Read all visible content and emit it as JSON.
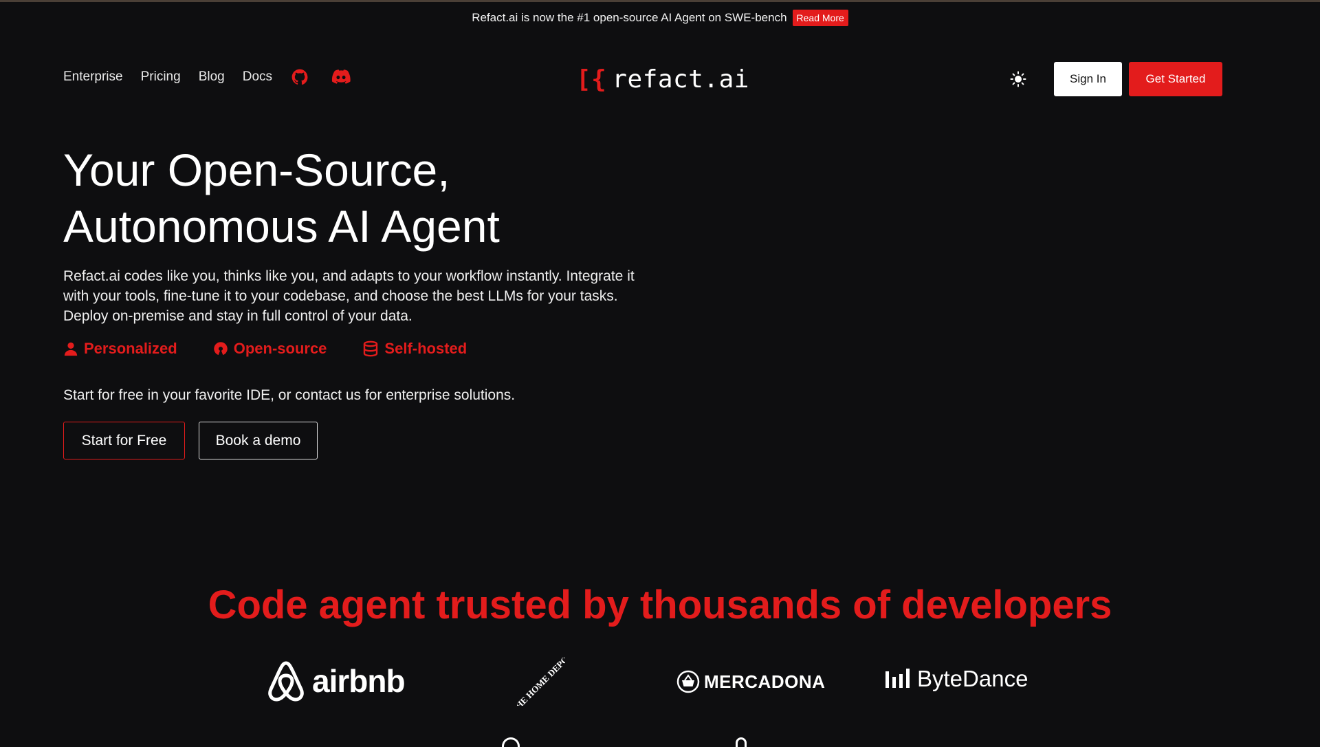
{
  "announcement": {
    "text": "Refact.ai is now the #1 open-source AI Agent on SWE-bench",
    "badge": "Read More"
  },
  "nav": {
    "links": [
      "Enterprise",
      "Pricing",
      "Blog",
      "Docs"
    ],
    "icons": [
      "github-icon",
      "discord-icon"
    ]
  },
  "logo": {
    "mark": "[{",
    "text": "refact.ai"
  },
  "header_right": {
    "theme_icon": "sun-icon",
    "sign_in": "Sign In",
    "get_started": "Get Started"
  },
  "hero": {
    "title_line1": "Your Open-Source,",
    "title_line2": "Autonomous AI Agent",
    "description": "Refact.ai codes like you, thinks like you, and adapts to your workflow instantly. Integrate it with your tools, fine-tune it to your codebase, and choose the best LLMs for your tasks. Deploy on-premise and stay in full control of your data.",
    "features": [
      {
        "label": "Personalized",
        "icon": "user-icon"
      },
      {
        "label": "Open-source",
        "icon": "open-source-icon"
      },
      {
        "label": "Self-hosted",
        "icon": "database-icon"
      }
    ],
    "cta_text": "Start for free in your favorite IDE, or contact us for enterprise solutions.",
    "start_free": "Start for Free",
    "book_demo": "Book a demo"
  },
  "trusted": {
    "heading": "Code agent trusted by thousands of developers",
    "logos": [
      "airbnb",
      "THE HOME DEPOT",
      "MERCADONA",
      "ByteDance"
    ]
  },
  "colors": {
    "background": "#0e0e10",
    "accent": "#e31c1c",
    "text": "#ffffff"
  }
}
